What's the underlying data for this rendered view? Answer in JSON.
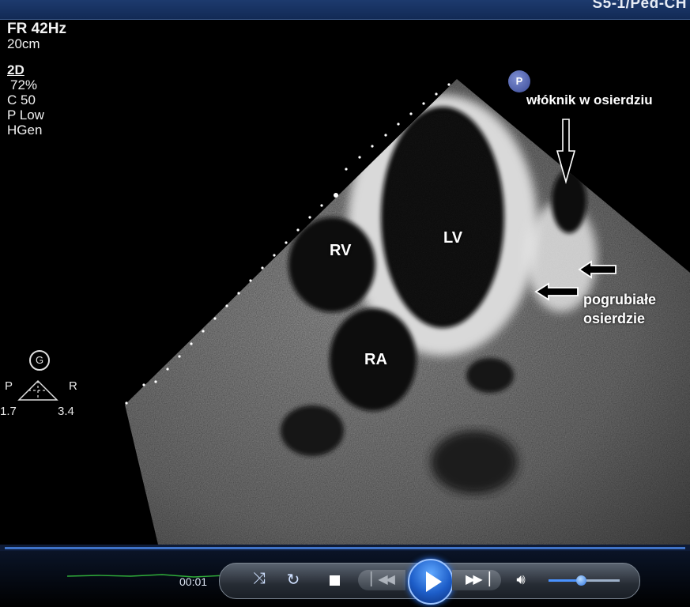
{
  "header": {
    "title": "S5-1/Ped-CH"
  },
  "params": {
    "frame_rate": "FR 42Hz",
    "depth": "20cm",
    "mode": "2D",
    "gain": "72%",
    "compression": "C 50",
    "power": "P Low",
    "frequency": "HGen"
  },
  "labels": {
    "rv": "RV",
    "lv": "LV",
    "ra": "RA"
  },
  "annotations": {
    "fibrin": "włóknik w osierdziu",
    "thickened_line1": "pogrubiałe",
    "thickened_line2": "osierdzie"
  },
  "marker": {
    "p": "P"
  },
  "orientation": {
    "g": "G",
    "left": "P",
    "right": "R",
    "left_value": "1.7",
    "right_value": "3.4"
  },
  "player": {
    "time": "00:01",
    "volume_level": 0.45,
    "icons": [
      "shuffle-icon",
      "repeat-icon",
      "stop-icon",
      "previous-icon",
      "play-icon",
      "next-icon",
      "volume-icon"
    ]
  },
  "colors": {
    "accent": "#3f73c8",
    "play": "#1d5dc8",
    "waveform": "#2fae3a"
  }
}
